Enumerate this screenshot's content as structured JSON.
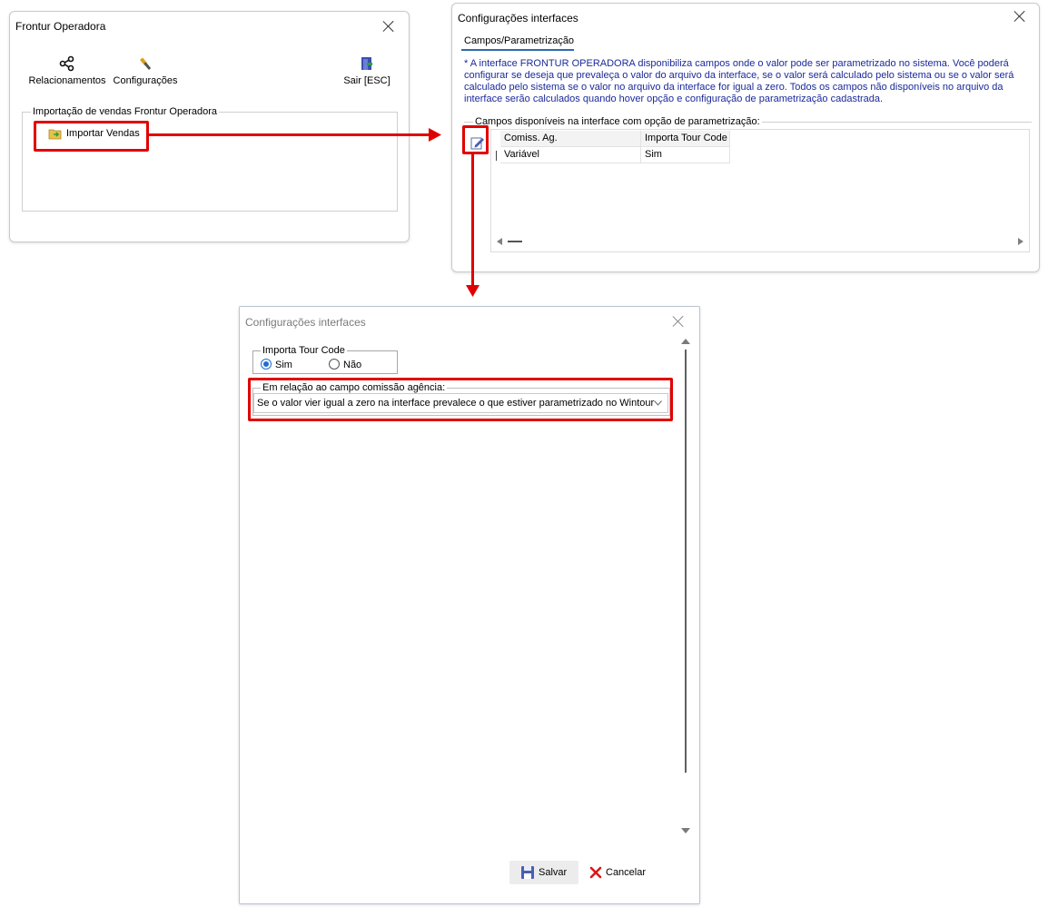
{
  "window1": {
    "title": "Frontur Operadora",
    "toolbar": {
      "relacionamentos": "Relacionamentos",
      "configuracoes": "Configurações",
      "sair": "Sair [ESC]"
    },
    "group_title": "Importação de vendas Frontur Operadora",
    "import_button": "Importar Vendas"
  },
  "window2": {
    "title": "Configurações interfaces",
    "tab": "Campos/Parametrização",
    "info_lines": [
      "* A interface FRONTUR OPERADORA disponibiliza campos onde o valor pode ser parametrizado no sistema. Você poderá",
      "configurar se deseja que prevaleça o valor do arquivo da interface, se o valor será calculado pelo sistema ou se o valor será",
      "calculado pelo sistema se o valor no arquivo da interface for igual a zero. Todos os campos não disponíveis no arquivo da",
      "interface serão calculados quando hover opção e configuração de parametrização cadastrada."
    ],
    "group_title": "Campos disponíveis na interface com opção de parametrização:",
    "table": {
      "columns": [
        "Comiss. Ag.",
        "Importa Tour Code"
      ],
      "rows": [
        [
          "Variável",
          "Sim"
        ]
      ]
    }
  },
  "window3": {
    "title": "Configurações interfaces",
    "tour_code_group": "Importa Tour Code",
    "radio_sim": "Sim",
    "radio_nao": "Não",
    "radio_selected": "Sim",
    "comissao_group": "Em relação ao campo comissão agência:",
    "comissao_value": "Se o valor vier igual a zero na interface prevalece o que estiver parametrizado no Wintour",
    "save_label": "Salvar",
    "cancel_label": "Cancelar"
  },
  "colors": {
    "highlight": "#e10000",
    "info_text": "#1a2a9a",
    "radio_accent": "#1f6fd1"
  }
}
